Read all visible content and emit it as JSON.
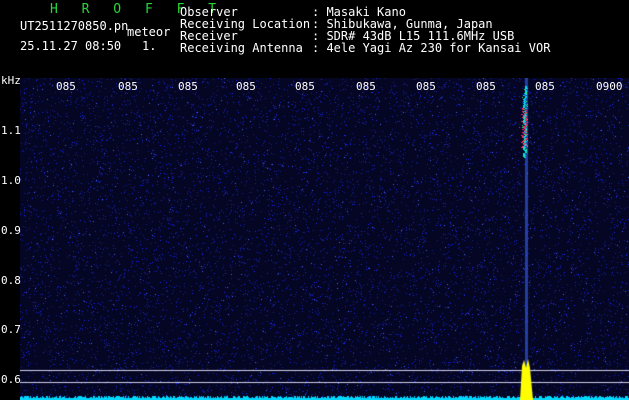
{
  "header": {
    "app_name": "H R O F F T",
    "filename": "UT2511270850.pn",
    "suffix": "meteor",
    "datetime": "25.11.27 08:50",
    "page_no": "1.",
    "fields": [
      {
        "label": "Observer",
        "value": ": Masaki Kano"
      },
      {
        "label": "Receiving Location",
        "value": ": Shibukawa, Gunma, Japan"
      },
      {
        "label": "Receiver",
        "value": ": SDR# 43dB L15 111.6MHz USB"
      },
      {
        "label": "Receiving Antenna",
        "value": ": 4ele Yagi Az 230 for Kansai VOR"
      }
    ]
  },
  "plot": {
    "y_unit": "kHz",
    "y_ticks": [
      "1.1",
      "1.0",
      "0.9",
      "0.8",
      "0.7",
      "0.6"
    ],
    "x_ticks": [
      "085",
      "085",
      "085",
      "085",
      "085",
      "085",
      "085",
      "085",
      "085",
      "0900"
    ],
    "colors": {
      "background": "#050524",
      "noise": "#1a2cff",
      "baseline": "#00d8ff",
      "burst": "#ffff00",
      "meteor": "#ff2a6a"
    }
  }
}
